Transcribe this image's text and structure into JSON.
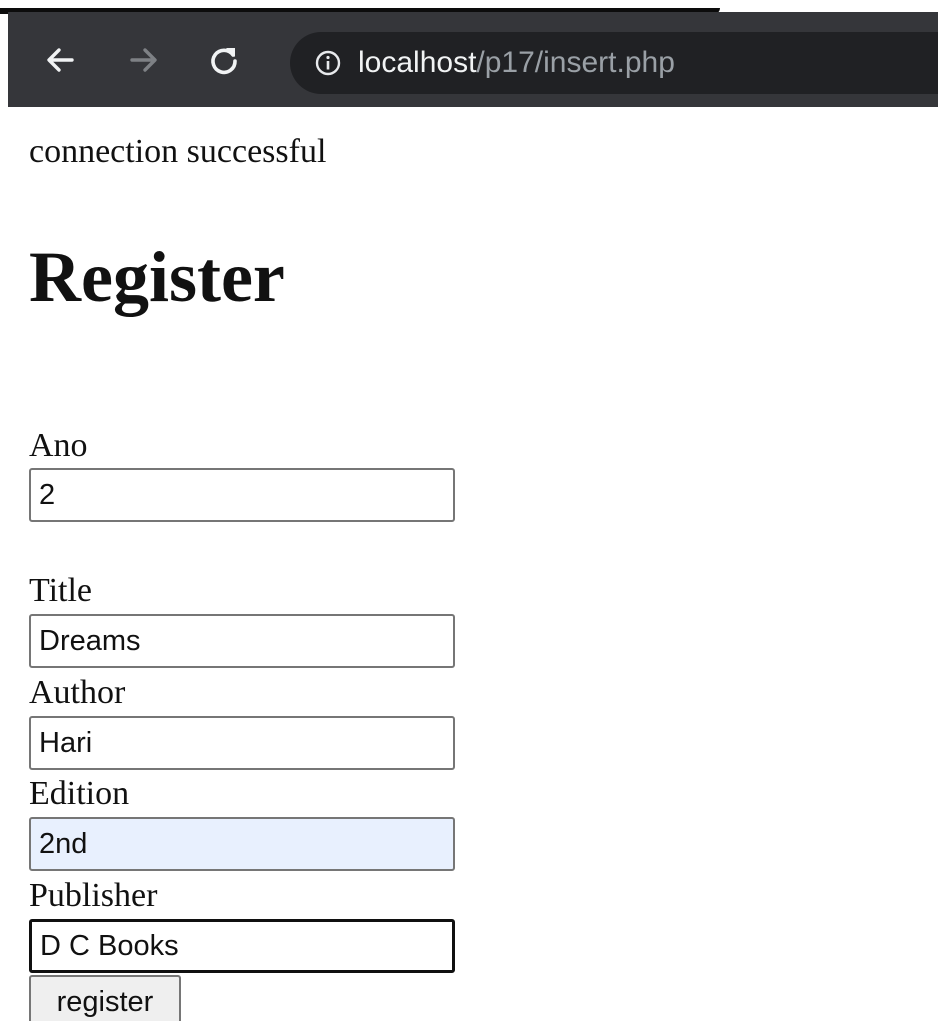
{
  "browser": {
    "url_host": "localhost",
    "url_path": "/p17/insert.php",
    "icons": {
      "back": "arrow-left-icon",
      "forward": "arrow-right-icon",
      "reload": "reload-icon",
      "site_info": "info-icon"
    },
    "colors": {
      "toolbar": "#35363a",
      "omnibox": "#202124",
      "url_host_text": "#f1f3f4",
      "url_path_text": "#9aa0a6"
    }
  },
  "page": {
    "status_message": "connection successful",
    "heading": "Register",
    "fields": [
      {
        "label": "Ano",
        "value": "2"
      },
      {
        "label": "Title",
        "value": "Dreams"
      },
      {
        "label": "Author",
        "value": "Hari"
      },
      {
        "label": "Edition",
        "value": "2nd",
        "autofilled": true
      },
      {
        "label": "Publisher",
        "value": "D C Books",
        "focused": true
      }
    ],
    "submit_label": "register",
    "colors": {
      "autofill_background": "#e8f0fe"
    }
  }
}
